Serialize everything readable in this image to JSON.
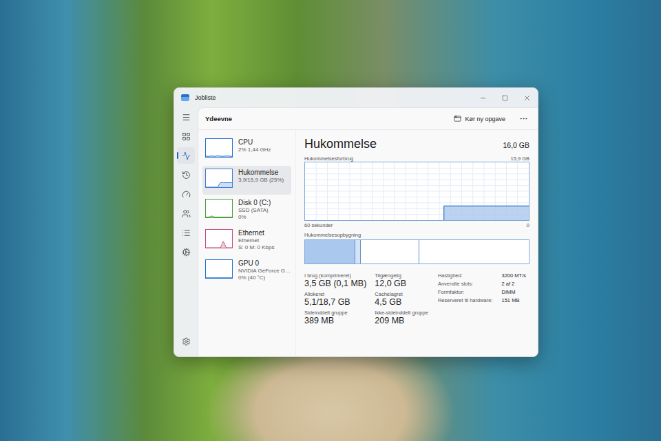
{
  "window": {
    "title": "Jobliste"
  },
  "nav": [
    {
      "selected": false
    },
    {
      "selected": false
    },
    {
      "selected": true
    },
    {
      "selected": false
    },
    {
      "selected": false
    },
    {
      "selected": false
    },
    {
      "selected": false
    },
    {
      "selected": false
    },
    {
      "selected": false
    }
  ],
  "header": {
    "title": "Ydeevne",
    "run_task": "Kør ny opgave"
  },
  "sidebar": {
    "items": [
      {
        "name": "CPU",
        "lines": [
          "2% 1,44 GHz"
        ],
        "selected": false,
        "color": "#1f6fd1",
        "graph": [
          0.04,
          0.03,
          0.05,
          0.03,
          0.06,
          0.04,
          0.03,
          0.05,
          0.04,
          0.03
        ]
      },
      {
        "name": "Hukommelse",
        "lines": [
          "3,9/15,9 GB (25%)"
        ],
        "selected": true,
        "color": "#3d7bd6",
        "graph": [
          0,
          0,
          0,
          0,
          0,
          0.25,
          0.25,
          0.25,
          0.25,
          0.25
        ]
      },
      {
        "name": "Disk 0 (C:)",
        "lines": [
          "SSD (SATA)",
          "0%"
        ],
        "selected": false,
        "color": "#4a9a3c",
        "graph": [
          0.02,
          0.02,
          0.08,
          0.02,
          0.02,
          0.02,
          0.02,
          0.02,
          0.02,
          0.02
        ]
      },
      {
        "name": "Ethernet",
        "lines": [
          "Ethernet",
          "S: 0 M: 0 Kbps"
        ],
        "selected": false,
        "color": "#c4497a",
        "graph": [
          0,
          0,
          0,
          0,
          0,
          0,
          0.35,
          0,
          0,
          0
        ]
      },
      {
        "name": "GPU 0",
        "lines": [
          "NVIDIA GeForce G…",
          "0% (40 °C)"
        ],
        "selected": false,
        "color": "#1f6fd1",
        "graph": [
          0.01,
          0.01,
          0.01,
          0.01,
          0.01,
          0.01,
          0.01,
          0.01,
          0.01,
          0.01
        ]
      }
    ]
  },
  "detail": {
    "title": "Hukommelse",
    "total": "16,0 GB",
    "chart": {
      "title": "Hukommelsesforbrug",
      "max_label": "15,9 GB",
      "max": 15.9,
      "x_start": "60 sekunder",
      "x_end": "0",
      "series": [
        {
          "values": [
            null,
            null,
            null,
            null,
            null,
            null,
            null,
            null,
            null,
            null,
            null,
            null,
            null,
            null,
            null,
            null,
            null,
            null,
            3.9,
            3.9,
            3.9,
            3.9,
            3.9,
            3.9,
            3.9,
            3.9,
            3.9,
            3.9,
            3.9,
            3.9
          ]
        }
      ]
    },
    "composition": {
      "title": "Hukommelsesopbygning",
      "segments": [
        {
          "kind": "filled",
          "level": 0.225
        },
        {
          "kind": "modified",
          "level": 0.023
        },
        {
          "kind": "outline",
          "level": 0.262
        },
        {
          "kind": "outline",
          "level": 0.49
        }
      ]
    },
    "stats": [
      {
        "label": "I brug (komprimeret)",
        "value": "3,5 GB (0,1 MB)"
      },
      {
        "label": "Tilgængelig",
        "value": "12,0 GB"
      },
      {
        "label": "Allokeret",
        "value": "5,1/18,7 GB"
      },
      {
        "label": "Cachelagret",
        "value": "4,5 GB"
      },
      {
        "label": "Sideinddelt gruppe",
        "value": "389 MB"
      },
      {
        "label": "Ikke-sideinddelt gruppe",
        "value": "209 MB"
      }
    ],
    "specs": [
      {
        "label": "Hastighed:",
        "value": "3200 MT/s"
      },
      {
        "label": "Anvendte slots:",
        "value": "2 af 2"
      },
      {
        "label": "Formfaktor:",
        "value": "DIMM"
      },
      {
        "label": "Reserveret til hardware:",
        "value": "151 MB"
      }
    ]
  }
}
